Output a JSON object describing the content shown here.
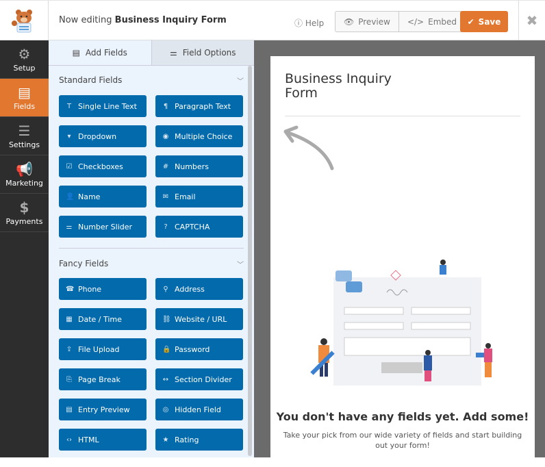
{
  "header": {
    "editing_prefix": "Now editing",
    "form_name": "Business Inquiry Form",
    "help": "Help",
    "preview": "Preview",
    "embed": "Embed",
    "save": "Save"
  },
  "sidebar": {
    "items": [
      {
        "label": "Setup",
        "icon": "gear-icon"
      },
      {
        "label": "Fields",
        "icon": "list-icon",
        "active": true
      },
      {
        "label": "Settings",
        "icon": "sliders-icon"
      },
      {
        "label": "Marketing",
        "icon": "megaphone-icon"
      },
      {
        "label": "Payments",
        "icon": "dollar-icon"
      }
    ]
  },
  "panel": {
    "tabs": [
      "Add Fields",
      "Field Options"
    ],
    "standard_title": "Standard Fields",
    "standard": [
      "Single Line Text",
      "Paragraph Text",
      "Dropdown",
      "Multiple Choice",
      "Checkboxes",
      "Numbers",
      "Name",
      "Email",
      "Number Slider",
      "CAPTCHA"
    ],
    "fancy_title": "Fancy Fields",
    "fancy": [
      "Phone",
      "Address",
      "Date / Time",
      "Website / URL",
      "File Upload",
      "Password",
      "Page Break",
      "Section Divider",
      "Entry Preview",
      "Hidden Field",
      "HTML",
      "Rating"
    ]
  },
  "form": {
    "title": "Business Inquiry Form",
    "empty_heading": "You don't have any fields yet. Add some!",
    "empty_text": "Take your pick from our wide variety of fields and start building out your form!"
  },
  "colors": {
    "accent": "#e27730",
    "field_button": "#036aab",
    "sidebar": "#2d2d2d"
  }
}
